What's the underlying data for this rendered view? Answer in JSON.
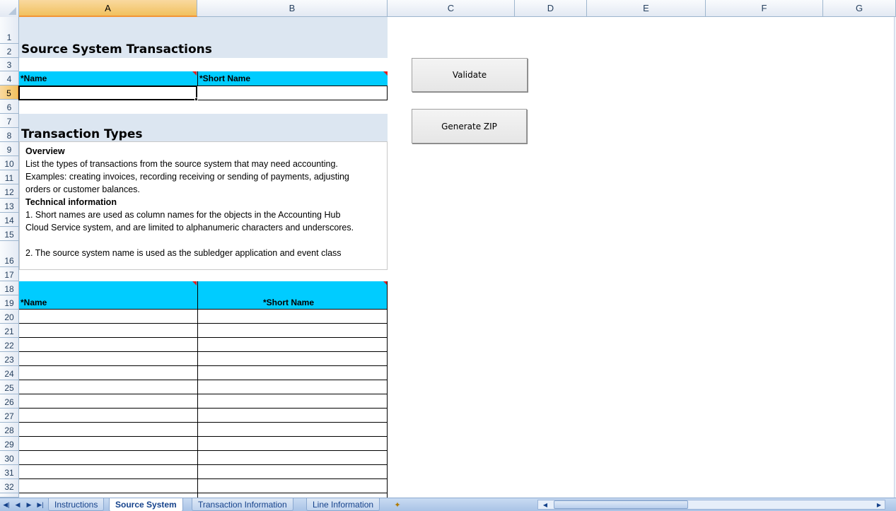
{
  "columns": [
    "A",
    "B",
    "C",
    "D",
    "E",
    "F",
    "G"
  ],
  "rows": [
    "1",
    "2",
    "3",
    "4",
    "5",
    "6",
    "7",
    "8",
    "9",
    "10",
    "11",
    "12",
    "13",
    "14",
    "15",
    "16",
    "17",
    "18",
    "19",
    "20",
    "21",
    "22",
    "23",
    "24",
    "25",
    "26",
    "27",
    "28",
    "29",
    "30",
    "31",
    "32"
  ],
  "source_section": {
    "title": "Source System Transactions",
    "col_name": "*Name",
    "col_short_name": "*Short Name"
  },
  "transaction_section": {
    "title": "Transaction Types",
    "col_name": "*Name",
    "col_short_name": "*Short Name"
  },
  "instructions": {
    "overview_heading": "Overview",
    "overview_line1": "List the types of transactions from the source system that may need accounting.",
    "overview_line2": "Examples: creating invoices, recording receiving or sending of payments, adjusting",
    "overview_line3": "orders or customer balances.",
    "tech_heading": "Technical information",
    "tech_line1": "1. Short names are used as column names for the objects in the Accounting Hub",
    "tech_line2": "Cloud Service system, and are limited to alphanumeric characters and underscores.",
    "tech_line3": "2. The source system name is used as the subledger application and event class"
  },
  "buttons": {
    "validate": "Validate",
    "generate_zip": "Generate ZIP"
  },
  "sheet_tabs": [
    {
      "label": "Instructions",
      "active": false
    },
    {
      "label": "Source System",
      "active": true
    },
    {
      "label": "Transaction Information",
      "active": false
    },
    {
      "label": "Line Information",
      "active": false
    }
  ],
  "nav_icons": [
    "first-sheet-icon",
    "prev-sheet-icon",
    "next-sheet-icon",
    "last-sheet-icon"
  ],
  "colors": {
    "header_band": "#dce6f1",
    "table_header": "#00ccff",
    "comment_marker": "#e02020"
  }
}
